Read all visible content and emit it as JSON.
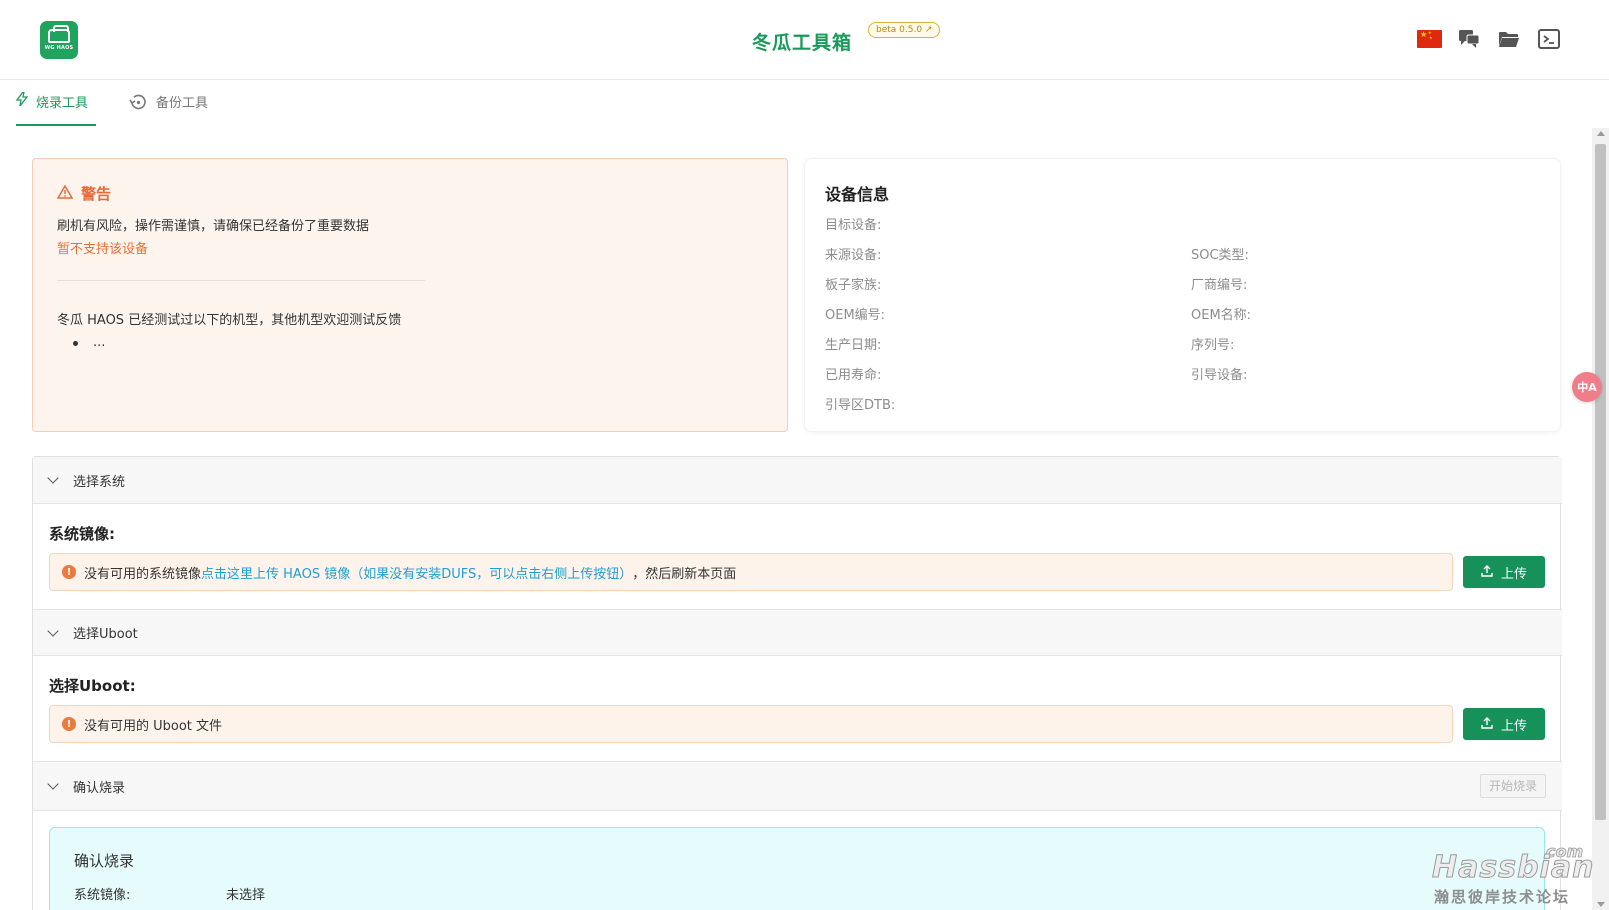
{
  "header": {
    "logo_text": "WG HAOS",
    "title": "冬瓜工具箱",
    "version": "beta 0.5.0",
    "icons": [
      "china-flag-icon",
      "chat-icon",
      "folder-icon",
      "terminal-icon"
    ]
  },
  "tabs": [
    {
      "label": "烧录工具",
      "icon": "flash-icon",
      "active": true
    },
    {
      "label": "备份工具",
      "icon": "history-icon",
      "active": false
    }
  ],
  "warning": {
    "title": "警告",
    "line1": "刷机有风险，操作需谨慎，请确保已经备份了重要数据",
    "line2": "暂不支持该设备",
    "tested": "冬瓜 HAOS 已经测试过以下的机型，其他机型欢迎测试反馈",
    "bullet": "..."
  },
  "device": {
    "title": "设备信息",
    "fields": {
      "target": "目标设备:",
      "source": "来源设备:",
      "soc": "SOC类型:",
      "board_family": "板子家族:",
      "vendor_id": "厂商编号:",
      "oem_id": "OEM编号:",
      "oem_name": "OEM名称:",
      "prod_date": "生产日期:",
      "serial": "序列号:",
      "life_used": "已用寿命:",
      "boot_device": "引导设备:",
      "boot_dtb": "引导区DTB:"
    }
  },
  "system_section": {
    "header": "选择系统",
    "label": "系统镜像:",
    "alert_prefix": "没有可用的系统镜像 ",
    "alert_link": "点击这里上传 HAOS 镜像（如果没有安装DUFS，可以点击右侧上传按钮）",
    "alert_suffix": "，然后刷新本页面",
    "upload_label": "上传"
  },
  "uboot_section": {
    "header": "选择Uboot",
    "label": "选择Uboot:",
    "alert": "没有可用的 Uboot 文件",
    "upload_label": "上传"
  },
  "confirm_section": {
    "header": "确认烧录",
    "start_label": "开始烧录",
    "box_title": "确认烧录",
    "image_label": "系统镜像:",
    "image_value": "未选择"
  },
  "watermark": {
    "com": "com",
    "brand": "Hassbian",
    "sub": "瀚思彼岸技术论坛"
  },
  "translate_fab": "中A",
  "colors": {
    "accent": "#1a9a5a",
    "button": "#17915a",
    "warning": "#e86a3a",
    "link": "#1f9ed4"
  }
}
